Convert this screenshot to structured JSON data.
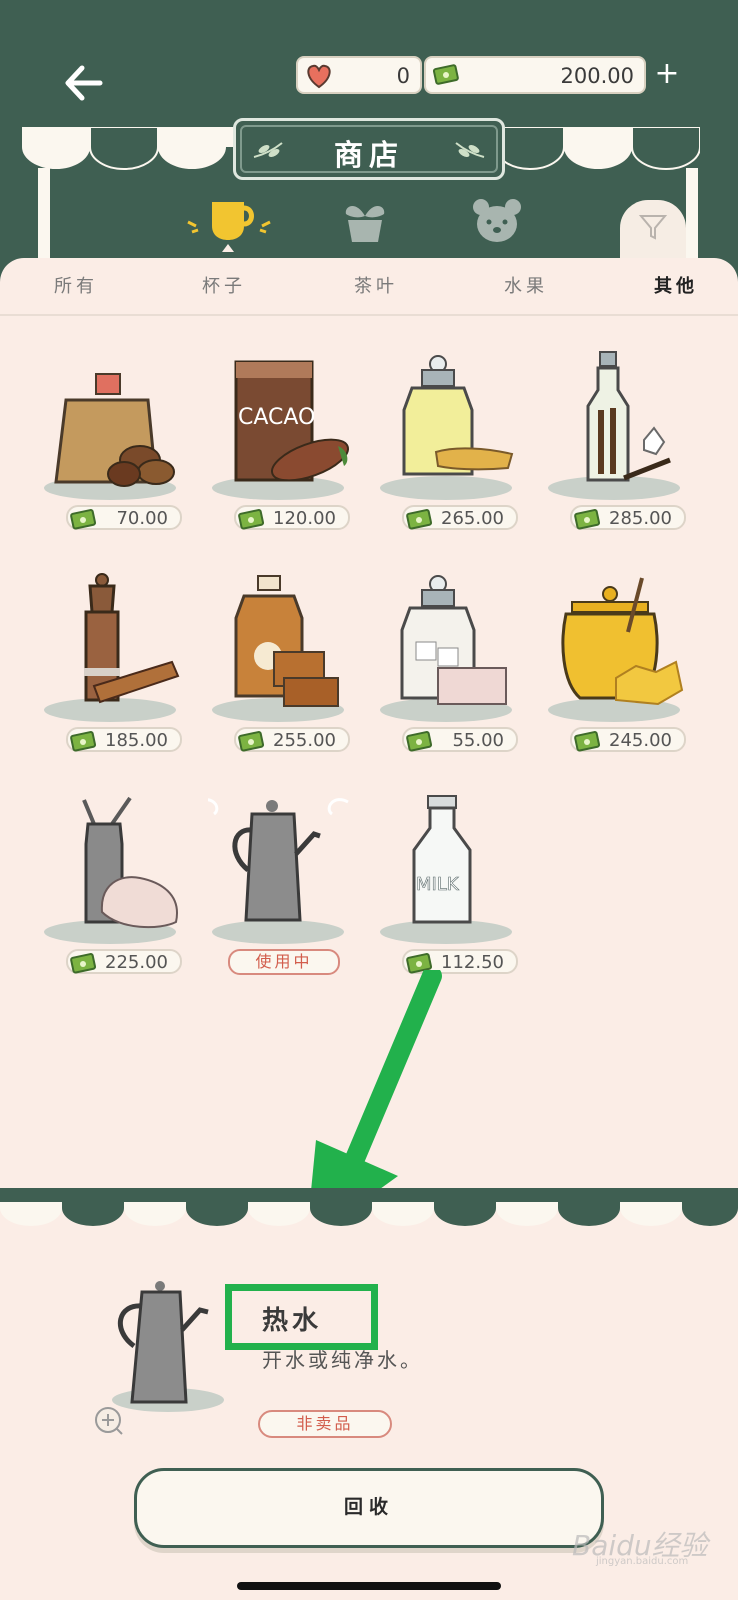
{
  "header": {
    "shop_title": "商店",
    "hearts_value": "0",
    "money_value": "200.00",
    "plus_label": "+"
  },
  "tabs": [
    {
      "label": "所有",
      "active": false
    },
    {
      "label": "杯子",
      "active": false
    },
    {
      "label": "茶叶",
      "active": false
    },
    {
      "label": "水果",
      "active": false
    },
    {
      "label": "其他",
      "active": true
    }
  ],
  "category_icons": [
    "cup-icon",
    "plant-pot-icon",
    "bear-icon",
    "filter-icon"
  ],
  "items": [
    {
      "name": "coffee-beans",
      "price": "70.00"
    },
    {
      "name": "cacao",
      "price": "120.00",
      "label_text": "CACAO"
    },
    {
      "name": "ginger-jar",
      "price": "265.00"
    },
    {
      "name": "vanilla-bottle",
      "price": "285.00"
    },
    {
      "name": "cinnamon",
      "price": "185.00"
    },
    {
      "name": "maple-syrup",
      "price": "255.00"
    },
    {
      "name": "sugar-cubes",
      "price": "55.00"
    },
    {
      "name": "honey",
      "price": "245.00"
    },
    {
      "name": "whipped-cream",
      "price": "225.00"
    },
    {
      "name": "hot-water-kettle",
      "status": "使用中"
    },
    {
      "name": "milk",
      "price": "112.50",
      "label_text": "MILK"
    }
  ],
  "detail": {
    "name": "热水",
    "description": "开水或纯净水。",
    "status": "非卖品",
    "action_label": "回收"
  },
  "watermark": {
    "text": "Baidu经验",
    "sub": "jingyan.baidu.com"
  },
  "colors": {
    "dark_green": "#3f5f52",
    "panel": "#fbede6",
    "highlight": "#22b14c",
    "red_text": "#d25d4c"
  }
}
